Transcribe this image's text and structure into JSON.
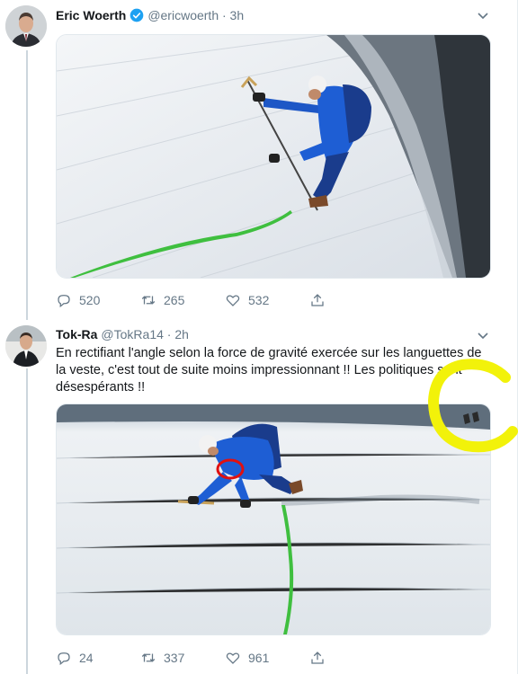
{
  "tweet1": {
    "name": "Eric Woerth",
    "handle": "@ericwoerth · 3h",
    "stats": {
      "replies": "520",
      "retweets": "265",
      "likes": "532"
    }
  },
  "tweet2": {
    "name": "Tok-Ra",
    "handle": "@TokRa14 · 2h",
    "text": "En rectifiant l'angle selon la force de gravité exercée sur les languettes de la veste, c'est tout de suite moins impressionnant !! Les politiques sont désespérants !!",
    "stats": {
      "replies": "24",
      "retweets": "337",
      "likes": "961"
    }
  },
  "colors": {
    "verified": "#1da1f2",
    "highlight_yellow": "#f2f20a",
    "highlight_red": "#e01010",
    "meta": "#657786"
  },
  "icons": [
    "verified-badge-icon",
    "chevron-down-icon",
    "reply-icon",
    "retweet-icon",
    "like-icon",
    "share-icon"
  ]
}
